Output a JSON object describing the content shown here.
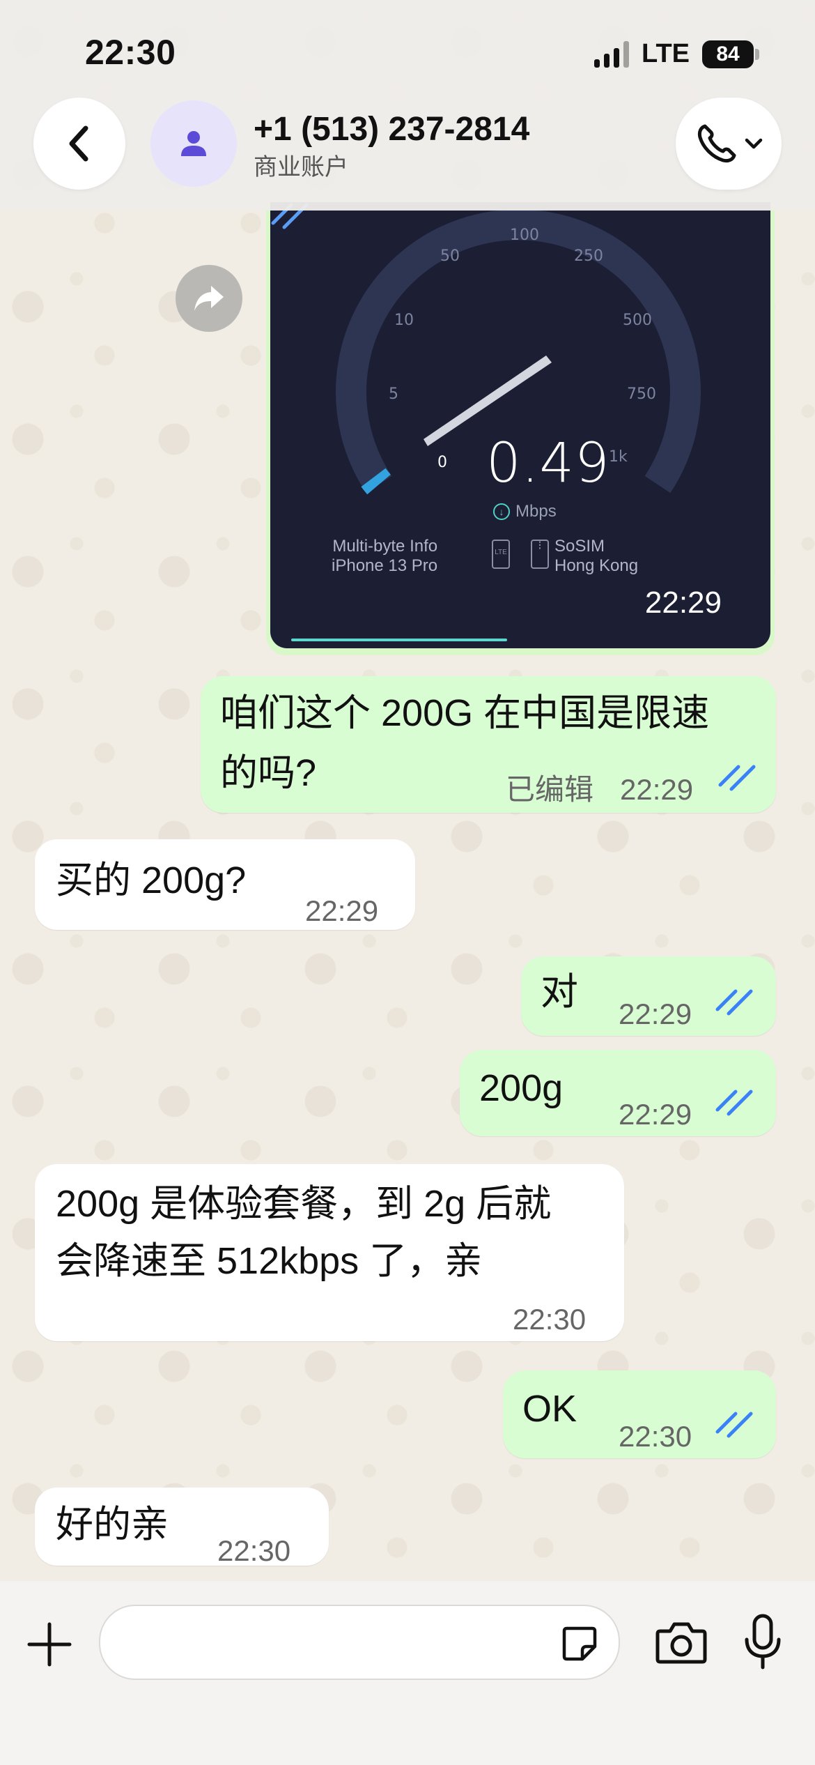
{
  "status_bar": {
    "time": "22:30",
    "network": "LTE",
    "battery": "84"
  },
  "header": {
    "contact_name": "+1 (513) 237-2814",
    "contact_subtitle": "商业账户"
  },
  "speedtest": {
    "value": "0.49",
    "unit": "Mbps",
    "scale": [
      "0",
      "5",
      "10",
      "50",
      "100",
      "250",
      "500",
      "750",
      "1k"
    ],
    "provider": "Multi-byte Info",
    "device": "iPhone 13 Pro",
    "network_badge": "LTE",
    "server_name": "SoSIM",
    "server_location": "Hong Kong",
    "time": "22:29"
  },
  "messages": [
    {
      "direction": "out",
      "text_line1": "咱们这个 200G 在中国是限速",
      "text_line2": "的吗?",
      "edited": "已编辑",
      "time": "22:29"
    },
    {
      "direction": "in",
      "text": "买的 200g?",
      "time": "22:29"
    },
    {
      "direction": "out",
      "text": "对",
      "time": "22:29"
    },
    {
      "direction": "out",
      "text": "200g",
      "time": "22:29"
    },
    {
      "direction": "in",
      "text_line1": "200g 是体验套餐，到 2g 后就",
      "text_line2": "会降速至 512kbps 了，亲",
      "time": "22:30"
    },
    {
      "direction": "out",
      "text": "OK",
      "time": "22:30"
    },
    {
      "direction": "in",
      "text": "好的亲",
      "time": "22:30"
    }
  ],
  "colors": {
    "outgoing_bubble": "#d9fdd3",
    "incoming_bubble": "#ffffff",
    "read_ticks": "#3b82f6",
    "avatar_bg": "#e7e3fb",
    "avatar_icon": "#5b4bd6"
  },
  "icons": [
    "back-icon",
    "person-icon",
    "phone-icon",
    "chevron-down-icon",
    "forward-icon",
    "plus-icon",
    "sticker-icon",
    "camera-icon",
    "mic-icon"
  ]
}
